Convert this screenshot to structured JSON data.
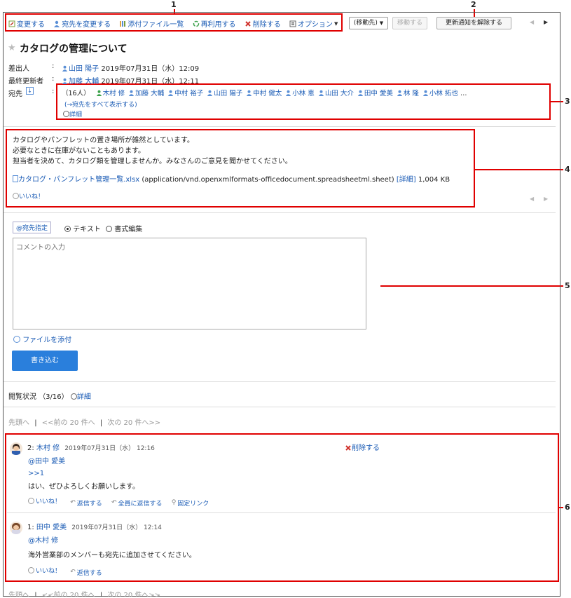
{
  "callouts": [
    "1",
    "2",
    "3",
    "4",
    "5",
    "6"
  ],
  "toolbar": {
    "edit": "変更する",
    "change_recipients": "宛先を変更する",
    "attachments": "添付ファイル一覧",
    "reuse": "再利用する",
    "delete": "削除する",
    "options": "オプション",
    "move_select": "(移動先)",
    "move_button": "移動する",
    "unsubscribe": "更新通知を解除する"
  },
  "message": {
    "title": "カタログの管理について",
    "sender_label": "差出人",
    "sender_name": "山田 陽子",
    "sender_date": "2019年07月31日（水）12:09",
    "updater_label": "最終更新者",
    "updater_name": "加藤 大輔",
    "updater_date": "2019年07月31日（水）12:11",
    "recipients_label": "宛先",
    "recipients_count": "（16人）",
    "recipients": [
      "木村 修",
      "加藤 大輔",
      "中村 裕子",
      "山田 陽子",
      "中村 健太",
      "小林 恵",
      "山田 大介",
      "田中 愛美",
      "林 隆",
      "小林 拓也"
    ],
    "recipients_more": "…",
    "show_all": "(→宛先をすべて表示する)",
    "details": "詳細",
    "body_lines": [
      "カタログやパンフレットの置き場所が雑然としています。",
      "必要なときに在庫がないこともあります。",
      "担当者を決めて、カタログ類を管理しませんか。みなさんのご意見を聞かせてください。"
    ],
    "file_name": "カタログ・パンフレット管理一覧.xlsx",
    "file_type": "(application/vnd.openxmlformats-officedocument.spreadsheetml.sheet)",
    "file_details": "[詳細]",
    "file_size": "1,004 KB",
    "like": "いいね！"
  },
  "comment_form": {
    "mention": "@宛先指定",
    "mode_text": "テキスト",
    "mode_rich": "書式編集",
    "placeholder": "コメントの入力",
    "attach": "ファイルを添付",
    "submit": "書き込む"
  },
  "read_status": {
    "label": "閲覧状況",
    "count": "（3/16）",
    "details": "詳細"
  },
  "pagination": {
    "first": "先頭へ",
    "prev": "<<前の 20 件へ",
    "next": "次の 20 件へ>>",
    "sep": "|"
  },
  "comments": [
    {
      "num": "2:",
      "author": "木村 修",
      "date": "2019年07月31日（水） 12:16",
      "delete": "削除する",
      "mention": "@田中 愛美",
      "quote": ">>1",
      "text": "はい、ぜひよろしくお願いします。",
      "like": "いいね！",
      "reply": "返信する",
      "reply_all": "全員に返信する",
      "permalink": "固定リンク"
    },
    {
      "num": "1:",
      "author": "田中 愛美",
      "date": "2019年07月31日（水） 12:14",
      "mention": "@木村 修",
      "text": "海外営業部のメンバーも宛先に追加させてください。",
      "like": "いいね！",
      "reply": "返信する"
    }
  ],
  "colors": {
    "accent_button": "#2a7fdc",
    "callout": "#e00000",
    "link": "#1a5bb5"
  }
}
